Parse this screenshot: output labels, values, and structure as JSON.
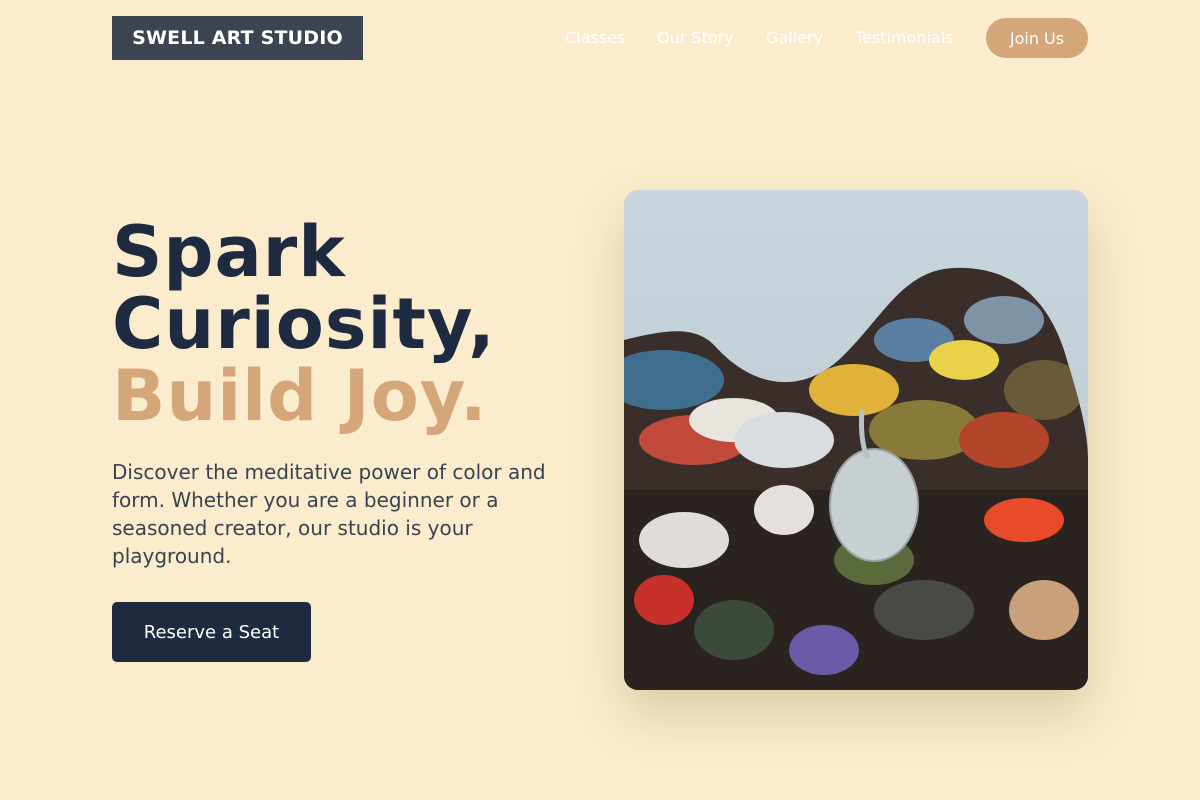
{
  "brand": {
    "name": "SWELL ART STUDIO"
  },
  "nav": {
    "links": [
      "Classes",
      "Our Story",
      "Gallery",
      "Testimonials"
    ],
    "join_label": "Join Us"
  },
  "hero": {
    "headline_line1": "Spark",
    "headline_line2": "Curiosity,",
    "headline_line3": "Build Joy.",
    "description": "Discover the meditative power of color and form. Whether you are a beginner or a seasoned creator, our studio is your playground.",
    "cta_label": "Reserve a Seat"
  },
  "colors": {
    "background": "#faeccc",
    "brand_box": "#3d4451",
    "accent": "#d5a67a",
    "navy": "#1e2a3f"
  },
  "image": {
    "subject": "paint-palette-photo"
  }
}
